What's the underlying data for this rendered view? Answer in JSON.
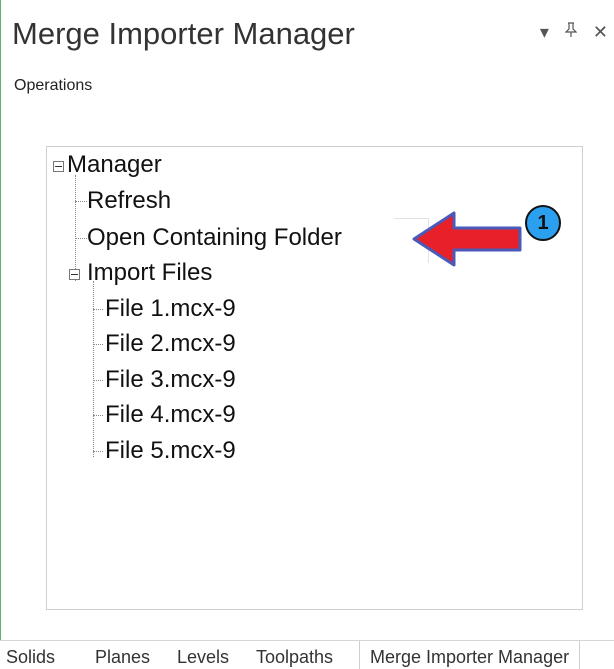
{
  "panel": {
    "title": "Merge Importer Manager",
    "operations_label": "Operations"
  },
  "tree": {
    "root": "Manager",
    "items": [
      "Refresh",
      "Open Containing Folder"
    ],
    "group": "Import Files",
    "files": [
      "File 1.mcx-9",
      "File 2.mcx-9",
      "File 3.mcx-9",
      "File 4.mcx-9",
      "File 5.mcx-9"
    ]
  },
  "annotation": {
    "number": "1",
    "arrow_color": "#e8202a",
    "circle_color": "#2b9ff0"
  },
  "tabs": [
    "Solids",
    "Planes",
    "Levels",
    "Toolpaths",
    "Merge Importer Manager"
  ],
  "active_tab": "Merge Importer Manager"
}
